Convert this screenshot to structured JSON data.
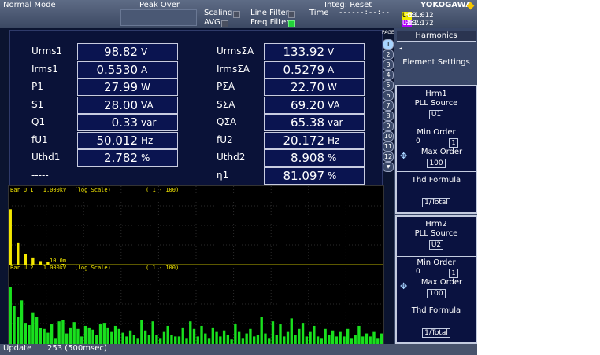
{
  "topbar": {
    "mode": "Normal Mode",
    "peak_over": "Peak Over",
    "scaling": "Scaling",
    "avg": "AVG",
    "line_filter": "Line Filter",
    "freq_filter": "Freq Filter",
    "integ": "Integ: Reset",
    "time_label": "Time",
    "time_value": "------:--:--",
    "pll1_label": "PLL1:",
    "pll1_tag": "U1",
    "pll1_value": "50.012",
    "pll1_unit": "Hz",
    "pll2_label": "PLL2:",
    "pll2_tag": "U2",
    "pll2_value": "20.172",
    "pll2_unit": "Hz",
    "brand": "YOKOGAWA"
  },
  "measurements": {
    "left": [
      {
        "label": "Urms1",
        "value": "98.82",
        "unit": "V"
      },
      {
        "label": "Irms1",
        "value": "0.5530",
        "unit": "A"
      },
      {
        "label": "P1",
        "value": "27.99",
        "unit": "W"
      },
      {
        "label": "S1",
        "value": "28.00",
        "unit": "VA"
      },
      {
        "label": "Q1",
        "value": "0.33",
        "unit": "var"
      },
      {
        "label": "fU1",
        "value": "50.012",
        "unit": "Hz"
      },
      {
        "label": "Uthd1",
        "value": "2.782",
        "unit": "%"
      },
      {
        "label": "-----",
        "value": "",
        "unit": ""
      }
    ],
    "right": [
      {
        "label": "UrmsΣA",
        "value": "133.92",
        "unit": "V"
      },
      {
        "label": "IrmsΣA",
        "value": "0.5279",
        "unit": "A"
      },
      {
        "label": "PΣA",
        "value": "22.70",
        "unit": "W"
      },
      {
        "label": "SΣA",
        "value": "69.20",
        "unit": "VA"
      },
      {
        "label": "QΣA",
        "value": "65.38",
        "unit": "var"
      },
      {
        "label": "fU2",
        "value": "20.172",
        "unit": "Hz"
      },
      {
        "label": "Uthd2",
        "value": "8.908",
        "unit": "%"
      },
      {
        "label": "η1",
        "value": "81.097",
        "unit": "%"
      }
    ]
  },
  "pages": {
    "label": "PAGE",
    "items": [
      "1",
      "2",
      "3",
      "4",
      "5",
      "6",
      "7",
      "8",
      "9",
      "10",
      "11",
      "12"
    ],
    "active": "1",
    "down_arrow": "▼"
  },
  "bar_graphs": {
    "bar1": {
      "name": "Bar U 1",
      "range": "1.000kV",
      "scale": "(log Scale)",
      "orders": "( 1 - 100)",
      "marker": "10.0m"
    },
    "bar2": {
      "name": "Bar U 2",
      "range": "1.000kV",
      "scale": "(log Scale)",
      "orders": "( 1 - 100)"
    },
    "bar1_levels": [
      0.93,
      0,
      0.37,
      0,
      0.18,
      0,
      0.12,
      0,
      0.06,
      0,
      0.05,
      0,
      0,
      0,
      0.03,
      0,
      0,
      0,
      0,
      0,
      0,
      0,
      0,
      0,
      0,
      0,
      0,
      0,
      0,
      0,
      0,
      0,
      0,
      0,
      0,
      0,
      0,
      0,
      0,
      0,
      0,
      0,
      0,
      0,
      0,
      0,
      0,
      0,
      0,
      0,
      0,
      0,
      0,
      0,
      0,
      0,
      0,
      0,
      0,
      0,
      0,
      0,
      0,
      0,
      0,
      0,
      0,
      0,
      0,
      0,
      0,
      0,
      0,
      0,
      0,
      0,
      0,
      0,
      0,
      0,
      0,
      0,
      0,
      0,
      0,
      0,
      0,
      0,
      0,
      0,
      0,
      0,
      0,
      0,
      0,
      0,
      0,
      0,
      0,
      0
    ],
    "bar2_levels": [
      0.75,
      0.5,
      0.36,
      0.58,
      0.28,
      0.25,
      0.42,
      0.36,
      0.21,
      0.2,
      0.15,
      0.26,
      0.08,
      0.3,
      0.32,
      0.14,
      0.22,
      0.29,
      0.2,
      0.1,
      0.24,
      0.22,
      0.19,
      0.12,
      0.26,
      0.28,
      0.22,
      0.16,
      0.24,
      0.2,
      0.15,
      0.1,
      0.18,
      0.12,
      0.08,
      0.32,
      0.18,
      0.12,
      0.3,
      0.12,
      0.08,
      0.16,
      0.24,
      0.12,
      0.1,
      0.1,
      0.22,
      0.08,
      0.3,
      0.2,
      0.1,
      0.24,
      0.14,
      0.08,
      0.22,
      0.16,
      0.1,
      0.18,
      0.12,
      0.06,
      0.26,
      0.16,
      0.08,
      0.14,
      0.2,
      0.1,
      0.12,
      0.36,
      0.14,
      0.08,
      0.3,
      0.12,
      0.26,
      0.1,
      0.16,
      0.34,
      0.12,
      0.2,
      0.28,
      0.1,
      0.16,
      0.24,
      0.1,
      0.08,
      0.2,
      0.12,
      0.18,
      0.1,
      0.16,
      0.1,
      0.2,
      0.08,
      0.12,
      0.24,
      0.1,
      0.14,
      0.1,
      0.16,
      0.08,
      0.14
    ],
    "colors": {
      "bar1": "#f4e800",
      "bar2": "#19e01e"
    }
  },
  "side_menu": {
    "title": "Harmonics",
    "element_settings": "Element Settings",
    "hrm1": {
      "title": "Hrm1",
      "pll_source_label": "PLL Source",
      "pll_source_value": "U1",
      "min_order_label": "Min Order",
      "min_order_a": "0",
      "min_order_b": "1",
      "max_order_label": "Max Order",
      "max_order_value": "100",
      "thd_formula_label": "Thd Formula",
      "thd_formula_value": "1/Total"
    },
    "hrm2": {
      "title": "Hrm2",
      "pll_source_label": "PLL Source",
      "pll_source_value": "U2",
      "min_order_label": "Min Order",
      "min_order_a": "0",
      "min_order_b": "1",
      "max_order_label": "Max Order",
      "max_order_value": "100",
      "thd_formula_label": "Thd Formula",
      "thd_formula_value": "1/Total"
    }
  },
  "status": {
    "update_label": "Update",
    "update_value": "253 (500msec)"
  }
}
